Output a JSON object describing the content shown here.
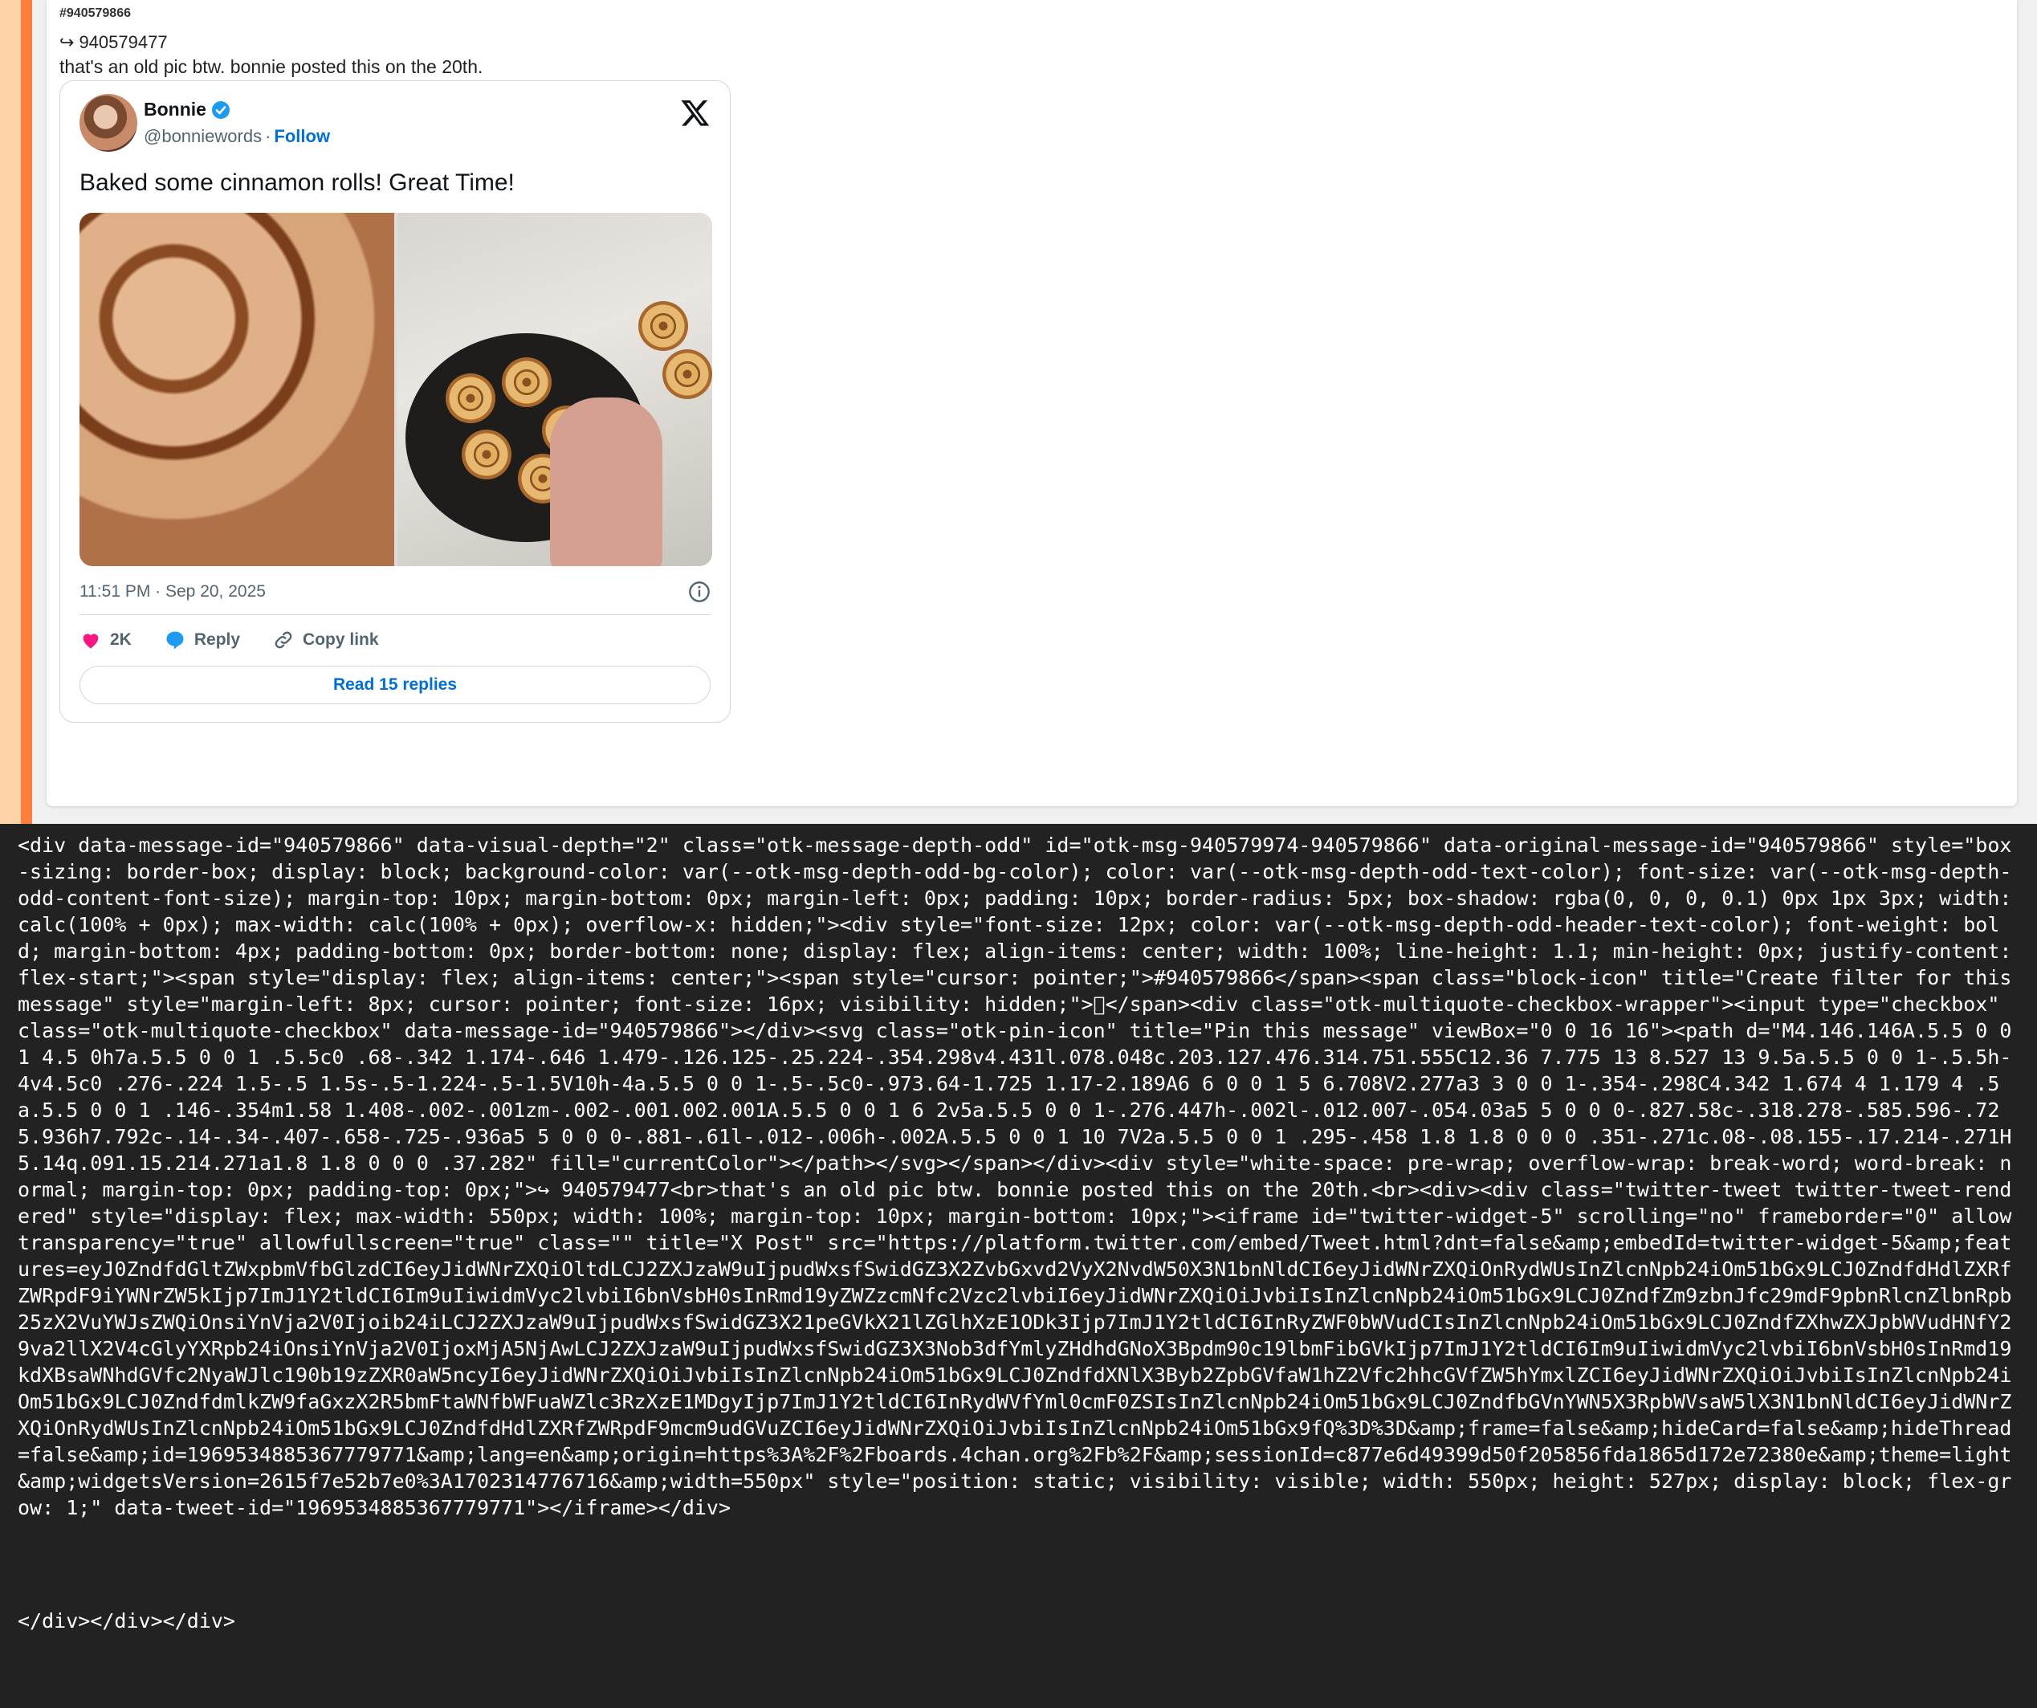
{
  "message": {
    "header_id": "#940579866",
    "quote_ref": "940579477",
    "text": "that's an old pic btw. bonnie posted this on the 20th."
  },
  "tweet": {
    "author_name": "Bonnie",
    "handle": "@bonniewords",
    "separator": "·",
    "follow_label": "Follow",
    "body": "Baked some cinnamon rolls! Great Time!",
    "timestamp": "11:51 PM · Sep 20, 2025",
    "like_count": "2K",
    "reply_label": "Reply",
    "copy_link_label": "Copy link",
    "read_replies_label": "Read 15 replies"
  },
  "source": {
    "code": "<div data-message-id=\"940579866\" data-visual-depth=\"2\" class=\"otk-message-depth-odd\" id=\"otk-msg-940579974-940579866\" data-original-message-id=\"940579866\" style=\"box-sizing: border-box; display: block; background-color: var(--otk-msg-depth-odd-bg-color); color: var(--otk-msg-depth-odd-text-color); font-size: var(--otk-msg-depth-odd-content-font-size); margin-top: 10px; margin-bottom: 0px; margin-left: 0px; padding: 10px; border-radius: 5px; box-shadow: rgba(0, 0, 0, 0.1) 0px 1px 3px; width: calc(100% + 0px); max-width: calc(100% + 0px); overflow-x: hidden;\"><div style=\"font-size: 12px; color: var(--otk-msg-depth-odd-header-text-color); font-weight: bold; margin-bottom: 4px; padding-bottom: 0px; border-bottom: none; display: flex; align-items: center; width: 100%; line-height: 1.1; min-height: 0px; justify-content: flex-start;\"><span style=\"display: flex; align-items: center;\"><span style=\"cursor: pointer;\">#940579866</span><span class=\"block-icon\" title=\"Create filter for this message\" style=\"margin-left: 8px; cursor: pointer; font-size: 16px; visibility: hidden;\">⃠</span><div class=\"otk-multiquote-checkbox-wrapper\"><input type=\"checkbox\" class=\"otk-multiquote-checkbox\" data-message-id=\"940579866\"></div><svg class=\"otk-pin-icon\" title=\"Pin this message\" viewBox=\"0 0 16 16\"><path d=\"M4.146.146A.5.5 0 0 1 4.5 0h7a.5.5 0 0 1 .5.5c0 .68-.342 1.174-.646 1.479-.126.125-.25.224-.354.298v4.431l.078.048c.203.127.476.314.751.555C12.36 7.775 13 8.527 13 9.5a.5.5 0 0 1-.5.5h-4v4.5c0 .276-.224 1.5-.5 1.5s-.5-1.224-.5-1.5V10h-4a.5.5 0 0 1-.5-.5c0-.973.64-1.725 1.17-2.189A6 6 0 0 1 5 6.708V2.277a3 3 0 0 1-.354-.298C4.342 1.674 4 1.179 4 .5a.5.5 0 0 1 .146-.354m1.58 1.408-.002-.001zm-.002-.001.002.001A.5.5 0 0 1 6 2v5a.5.5 0 0 1-.276.447h-.002l-.012.007-.054.03a5 5 0 0 0-.827.58c-.318.278-.585.596-.725.936h7.792c-.14-.34-.407-.658-.725-.936a5 5 0 0 0-.881-.61l-.012-.006h-.002A.5.5 0 0 1 10 7V2a.5.5 0 0 1 .295-.458 1.8 1.8 0 0 0 .351-.271c.08-.08.155-.17.214-.271H5.14q.091.15.214.271a1.8 1.8 0 0 0 .37.282\" fill=\"currentColor\"></path></svg></span></div><div style=\"white-space: pre-wrap; overflow-wrap: break-word; word-break: normal; margin-top: 0px; padding-top: 0px;\">↪ 940579477<br>that's an old pic btw. bonnie posted this on the 20th.<br><div><div class=\"twitter-tweet twitter-tweet-rendered\" style=\"display: flex; max-width: 550px; width: 100%; margin-top: 10px; margin-bottom: 10px;\"><iframe id=\"twitter-widget-5\" scrolling=\"no\" frameborder=\"0\" allowtransparency=\"true\" allowfullscreen=\"true\" class=\"\" title=\"X Post\" src=\"https://platform.twitter.com/embed/Tweet.html?dnt=false&amp;embedId=twitter-widget-5&amp;features=eyJ0ZndfdGltZWxpbmVfbGlzdCI6eyJidWNrZXQiOltdLCJ2ZXJzaW9uIjpudWxsfSwidGZ3X2ZvbGxvd2VyX2NvdW50X3N1bnNldCI6eyJidWNrZXQiOnRydWUsInZlcnNpb24iOm51bGx9LCJ0ZndfdHdlZXRfZWRpdF9iYWNrZW5kIjp7ImJ1Y2tldCI6Im9uIiwidmVyc2lvbiI6bnVsbH0sInRmd19yZWZzcmNfc2Vzc2lvbiI6eyJidWNrZXQiOiJvbiIsInZlcnNpb24iOm51bGx9LCJ0ZndfZm9zbnJfc29mdF9pbnRlcnZlbnRpb25zX2VuYWJsZWQiOnsiYnVja2V0Ijoib24iLCJ2ZXJzaW9uIjpudWxsfSwidGZ3X21peGVkX21lZGlhXzE1ODk3Ijp7ImJ1Y2tldCI6InRyZWF0bWVudCIsInZlcnNpb24iOm51bGx9LCJ0ZndfZXhwZXJpbWVudHNfY29va2llX2V4cGlyYXRpb24iOnsiYnVja2V0IjoxMjA5NjAwLCJ2ZXJzaW9uIjpudWxsfSwidGZ3X3Nob3dfYmlyZHdhdGNoX3Bpdm90c19lbmFibGVkIjp7ImJ1Y2tldCI6Im9uIiwidmVyc2lvbiI6bnVsbH0sInRmd19kdXBsaWNhdGVfc2NyaWJlc190b19zZXR0aW5ncyI6eyJidWNrZXQiOiJvbiIsInZlcnNpb24iOm51bGx9LCJ0ZndfdXNlX3Byb2ZpbGVfaW1hZ2Vfc2hhcGVfZW5hYmxlZCI6eyJidWNrZXQiOiJvbiIsInZlcnNpb24iOm51bGx9LCJ0ZndfdmlkZW9faGxzX2R5bmFtaWNfbWFuaWZlc3RzXzE1MDgyIjp7ImJ1Y2tldCI6InRydWVfYml0cmF0ZSIsInZlcnNpb24iOm51bGx9LCJ0ZndfbGVnYWN5X3RpbWVsaW5lX3N1bnNldCI6eyJidWNrZXQiOnRydWUsInZlcnNpb24iOm51bGx9LCJ0ZndfdHdlZXRfZWRpdF9mcm9udGVuZCI6eyJidWNrZXQiOiJvbiIsInZlcnNpb24iOm51bGx9fQ%3D%3D&amp;frame=false&amp;hideCard=false&amp;hideThread=false&amp;id=1969534885367779771&amp;lang=en&amp;origin=https%3A%2F%2Fboards.4chan.org%2Fb%2F&amp;sessionId=c877e6d49399d50f205856fda1865d172e72380e&amp;theme=light&amp;widgetsVersion=2615f7e52b7e0%3A1702314776716&amp;width=550px\" style=\"position: static; visibility: visible; width: 550px; height: 527px; display: block; flex-grow: 1;\" data-tweet-id=\"1969534885367779771\"></iframe></div>",
    "closing": "</div></div></div>"
  },
  "colors": {
    "follow_blue": "#006fd6",
    "heart_pink": "#f91880",
    "reply_blue": "#1d9bf0",
    "page_bg": "#222222"
  }
}
